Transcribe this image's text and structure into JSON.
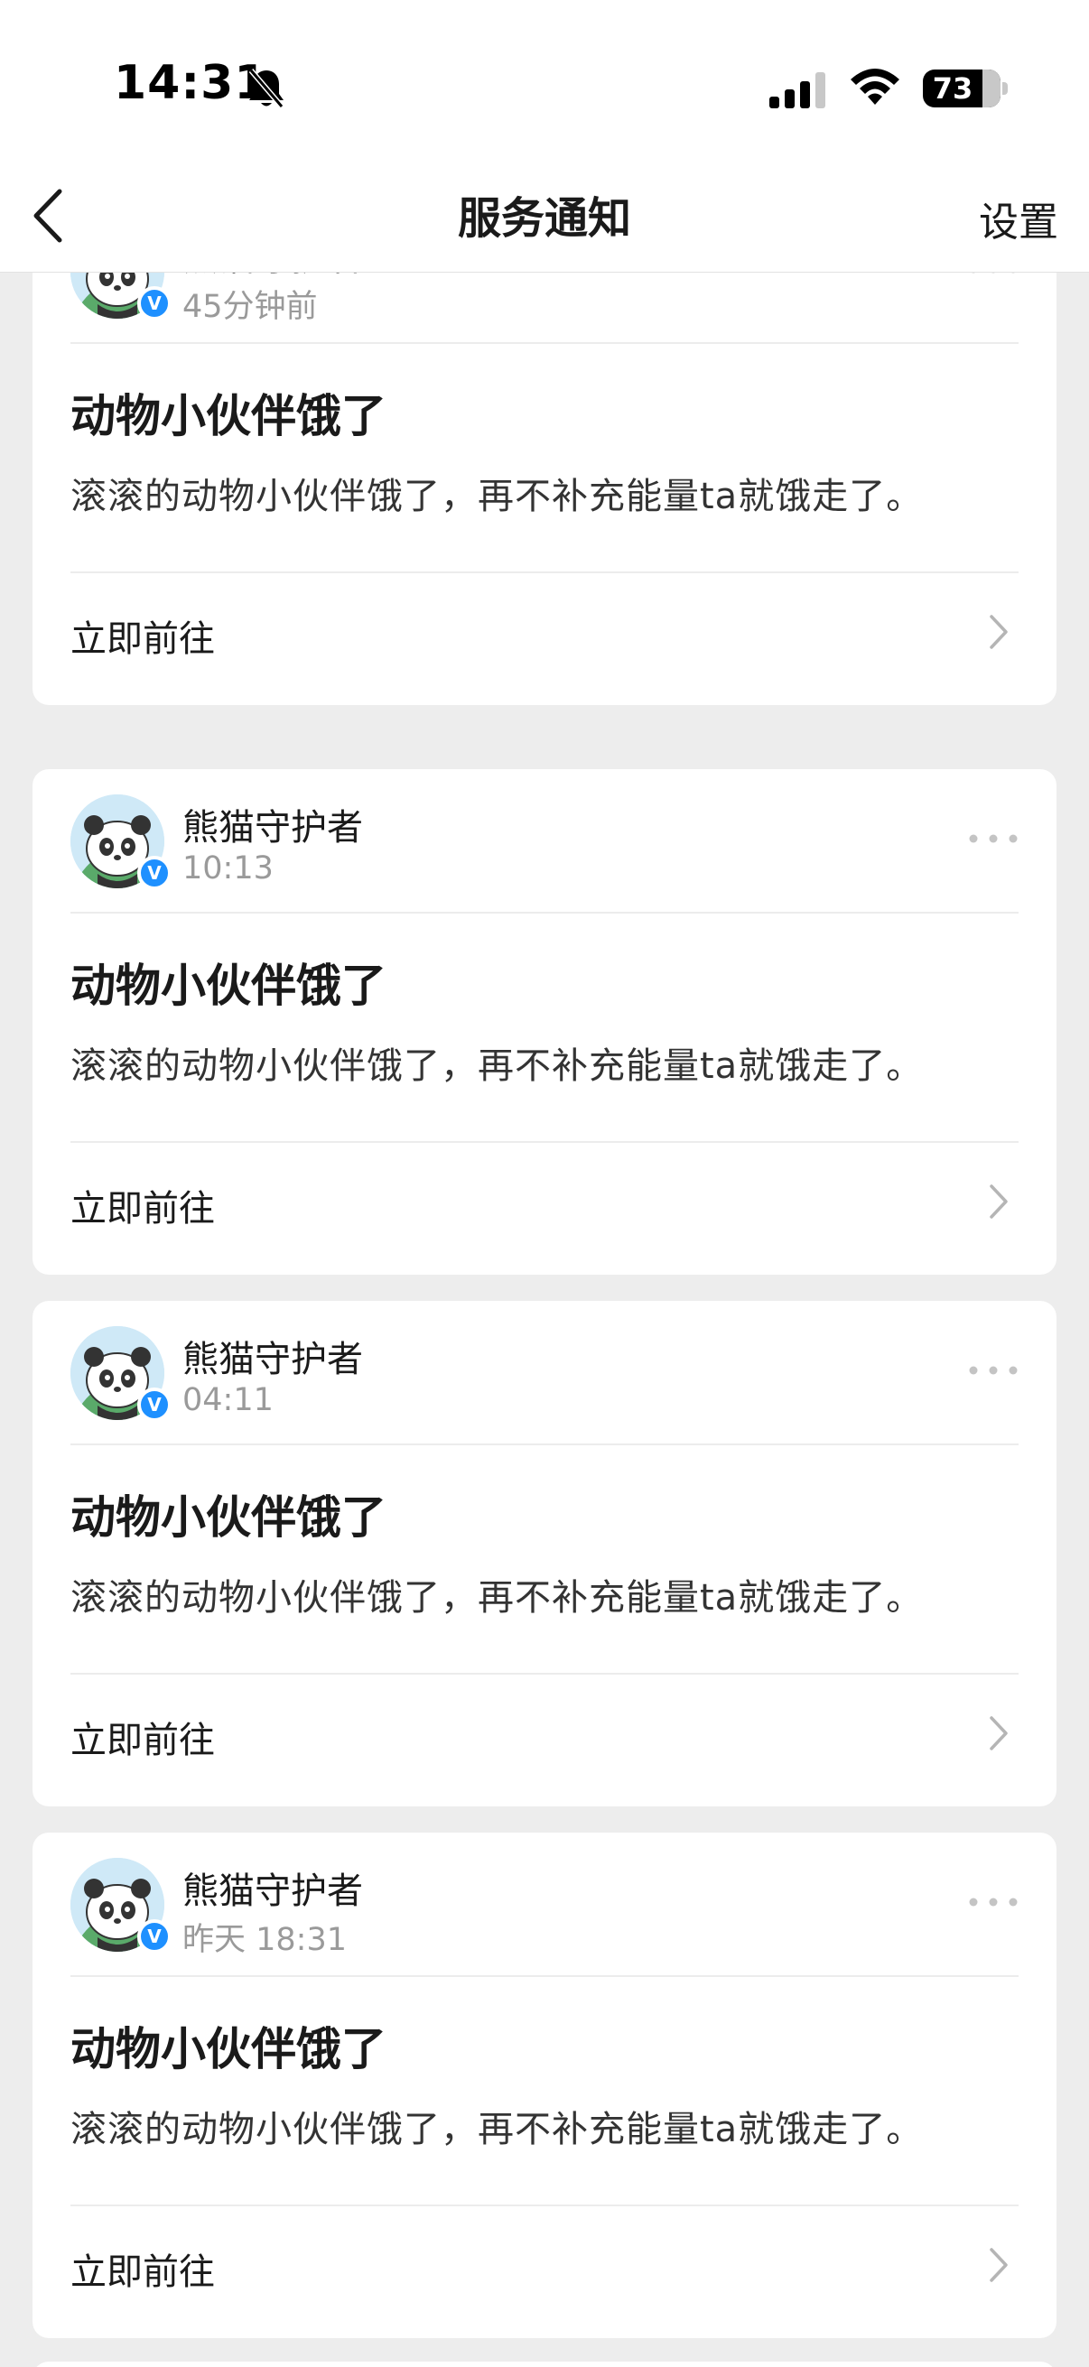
{
  "status_bar": {
    "time": "14:31",
    "battery": "73",
    "icons": [
      "bell-off-icon",
      "signal-icon",
      "wifi-icon",
      "battery-icon"
    ]
  },
  "nav": {
    "title": "服务通知",
    "settings_label": "设置",
    "back_icon": "chevron-left-icon"
  },
  "colors": {
    "background": "#ededed",
    "card": "#ffffff",
    "secondary_text": "#9a9a9a",
    "verified_badge": "#1e90ff",
    "avatar_bg": "#cfe9f7"
  },
  "notifications": [
    {
      "sender": "熊猫守护者",
      "time": "45分钟前",
      "title": "动物小伙伴饿了",
      "body": "滚滚的动物小伙伴饿了，再不补充能量ta就饿走了。",
      "action": "立即前往"
    },
    {
      "sender": "熊猫守护者",
      "time": "10:13",
      "title": "动物小伙伴饿了",
      "body": "滚滚的动物小伙伴饿了，再不补充能量ta就饿走了。",
      "action": "立即前往"
    },
    {
      "sender": "熊猫守护者",
      "time": "04:11",
      "title": "动物小伙伴饿了",
      "body": "滚滚的动物小伙伴饿了，再不补充能量ta就饿走了。",
      "action": "立即前往"
    },
    {
      "sender": "熊猫守护者",
      "time": "昨天 18:31",
      "title": "动物小伙伴饿了",
      "body": "滚滚的动物小伙伴饿了，再不补充能量ta就饿走了。",
      "action": "立即前往"
    }
  ]
}
